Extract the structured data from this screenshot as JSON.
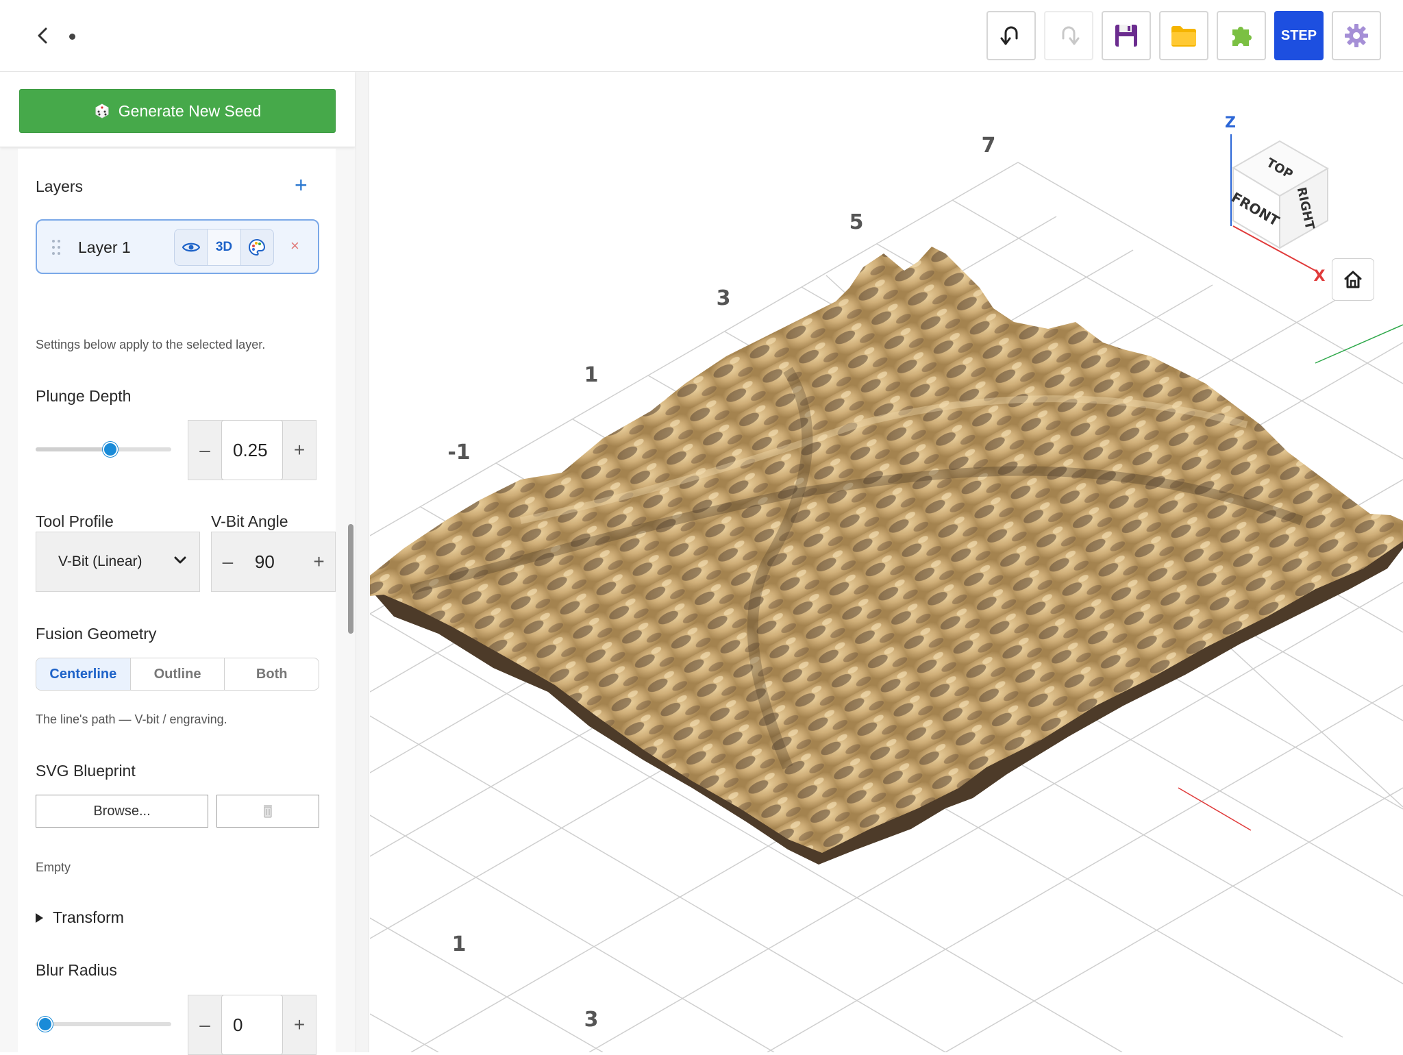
{
  "toolbar": {
    "step_label": "STEP"
  },
  "sidebar": {
    "seed_button": "Generate New Seed",
    "layers_title": "Layers",
    "add_layer": "+",
    "layer": {
      "name": "Layer 1",
      "mode_3d": "3D",
      "remove": "×"
    },
    "settings_note": "Settings below apply to the selected layer.",
    "plunge_depth": {
      "label": "Plunge Depth",
      "value": "0.25",
      "slider_fraction": 0.55
    },
    "tool_profile": {
      "label": "Tool Profile",
      "selected": "V-Bit (Linear)"
    },
    "vbit_angle": {
      "label": "V-Bit Angle",
      "value": "90"
    },
    "fusion_geometry": {
      "label": "Fusion Geometry",
      "options": [
        "Centerline",
        "Outline",
        "Both"
      ],
      "selected": "Centerline",
      "description": "The line's path — V-bit / engraving."
    },
    "svg_blueprint": {
      "label": "SVG Blueprint",
      "browse": "Browse...",
      "status": "Empty"
    },
    "transform_label": "Transform",
    "blur_radius": {
      "label": "Blur Radius",
      "value": "0",
      "slider_fraction": 0.05
    }
  },
  "viewport": {
    "grid_labels_back": [
      "-1",
      "1",
      "3",
      "5",
      "7"
    ],
    "grid_labels_front": [
      "1",
      "3"
    ],
    "axis_labels": {
      "z": "Z",
      "x": "X"
    },
    "cube_faces": {
      "top": "TOP",
      "front": "FRONT",
      "right": "RIGHT"
    },
    "terrain_color": "#d7b98a",
    "accent": "#1d4fe0"
  }
}
